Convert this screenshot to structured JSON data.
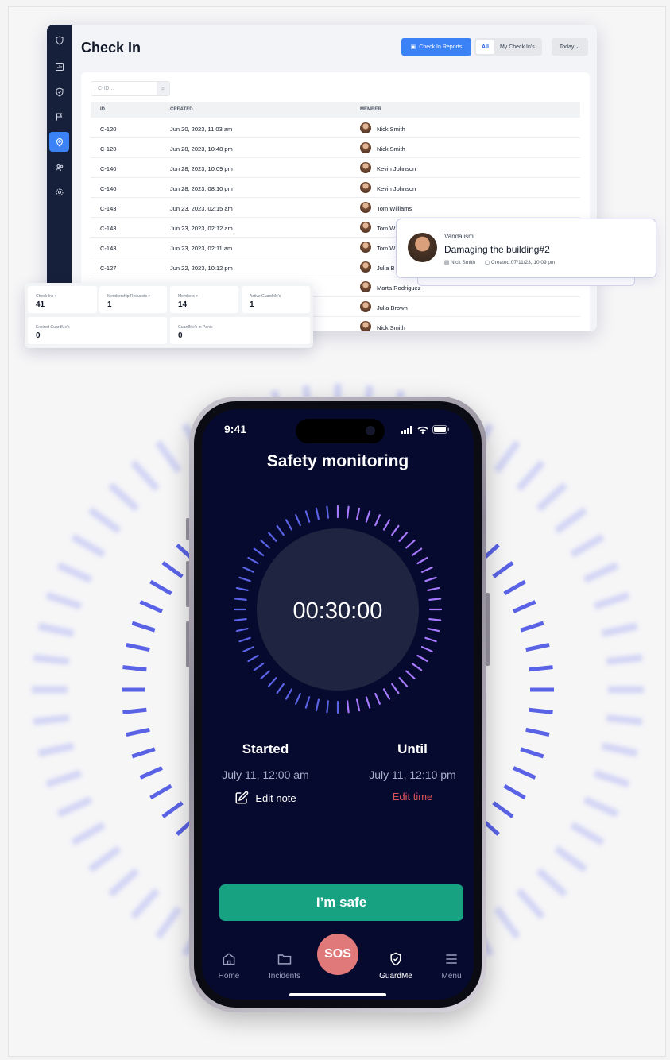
{
  "dashboard": {
    "title": "Check In",
    "report_button": "Check In Reports",
    "filters": [
      "All",
      "My Check In's"
    ],
    "period": "Today",
    "search_placeholder": "C-ID...",
    "columns": [
      "ID",
      "CREATED",
      "MEMBER"
    ],
    "rows": [
      {
        "id": "C-120",
        "created": "Jun 20, 2023, 11:03 am",
        "member": "Nick Smith"
      },
      {
        "id": "C-120",
        "created": "Jun 28, 2023, 10:48 pm",
        "member": "Nick Smith"
      },
      {
        "id": "C-140",
        "created": "Jun 28, 2023, 10:09 pm",
        "member": "Kevin Johnson"
      },
      {
        "id": "C-140",
        "created": "Jun 28, 2023, 08:10 pm",
        "member": "Kevin Johnson"
      },
      {
        "id": "C-143",
        "created": "Jun 23, 2023, 02:15 am",
        "member": "Tom Williams"
      },
      {
        "id": "C-143",
        "created": "Jun 23, 2023, 02:12 am",
        "member": "Tom W"
      },
      {
        "id": "C-143",
        "created": "Jun 23, 2023, 02:11 am",
        "member": "Tom W"
      },
      {
        "id": "C-127",
        "created": "Jun 22, 2023, 10:12 pm",
        "member": "Julia B"
      },
      {
        "id": "",
        "created": "",
        "member": "Marta Rodriguez"
      },
      {
        "id": "",
        "created": "",
        "member": "Julia Brown"
      },
      {
        "id": "",
        "created": "",
        "member": "Nick Smith"
      }
    ],
    "stats": [
      {
        "label": "Check Ins >",
        "value": "41"
      },
      {
        "label": "Membership Requests >",
        "value": "1"
      },
      {
        "label": "Members >",
        "value": "14"
      },
      {
        "label": "Active GuardMe's",
        "value": "1"
      },
      {
        "label": "Expired GuardMe's",
        "value": "0"
      },
      {
        "label": "GuardMe's in Panic",
        "value": "0"
      }
    ],
    "incident": {
      "type": "Vandalism",
      "title": "Damaging the building#2",
      "member": "Nick Smith",
      "created": "Created:07/11/23, 10:09 pm"
    }
  },
  "phone": {
    "clock": "9:41",
    "title": "Safety monitoring",
    "timer": "00:30:00",
    "started_label": "Started",
    "started_value": "July 11, 12:00 am",
    "edit_note": "Edit note",
    "until_label": "Until",
    "until_value": "July 11, 12:10 pm",
    "edit_time": "Edit time",
    "safe_button": "I’m safe",
    "tabs": [
      "Home",
      "Incidents",
      "SOS",
      "GuardMe",
      "Menu"
    ],
    "colors": {
      "background": "#060a2e",
      "accent_green": "#17a282",
      "sos": "#e07a7a",
      "edit_time": "#e0555c",
      "ticks_bright": "#a779ff",
      "ticks_dim": "#5a63e6"
    }
  }
}
